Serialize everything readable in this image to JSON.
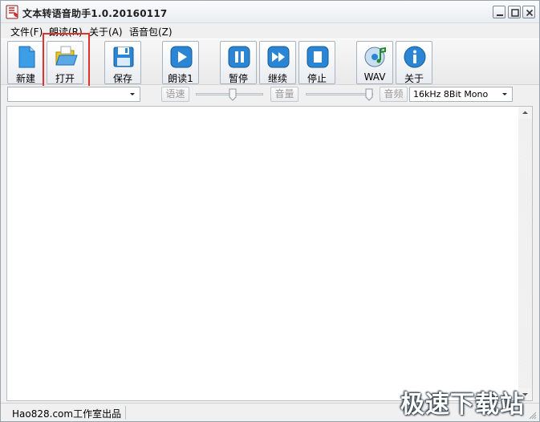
{
  "window": {
    "title": "文本转语音助手1.0.20160117",
    "controls": {
      "minimize": "minimize",
      "maximize": "maximize",
      "close": "close"
    }
  },
  "menu": [
    {
      "label": "文件(F)"
    },
    {
      "label": "朗读(R)"
    },
    {
      "label": "关于(A)"
    },
    {
      "label": "语音包(Z)"
    }
  ],
  "toolbar": {
    "new_label": "新建",
    "open_label": "打开",
    "save_label": "保存",
    "read_label": "朗读1",
    "pause_label": "暂停",
    "continue_label": "继续",
    "stop_label": "停止",
    "wav_label": "WAV",
    "about_label": "关于",
    "highlighted": "open"
  },
  "controls": {
    "voice_select_value": "",
    "speed_label": "语速",
    "speed_level": 0.55,
    "volume_label": "音量",
    "volume_level": 1.0,
    "freq_label": "音频",
    "format_value": "16kHz 8Bit Mono"
  },
  "editor": {
    "text": ""
  },
  "status": {
    "text": "Hao828.com工作室出品"
  },
  "watermark": {
    "text": "极速下载站"
  },
  "colors": {
    "accent_blue": "#2a86d4",
    "highlight_red": "#e0312d",
    "background": "#f0f0f0"
  }
}
